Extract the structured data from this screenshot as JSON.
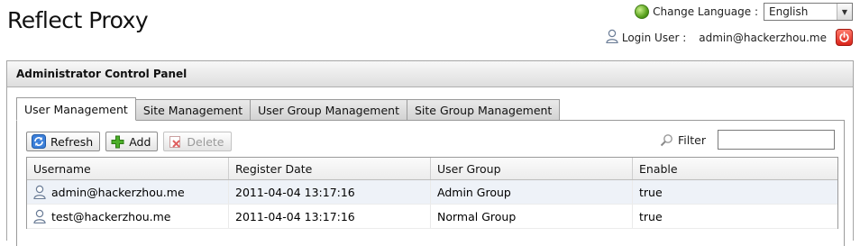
{
  "app": {
    "title": "Reflect Proxy"
  },
  "header": {
    "language_label": "Change Language :",
    "language_value": "English",
    "login_label": "Login User :",
    "login_value": "admin@hackerzhou.me"
  },
  "panel": {
    "title": "Administrator Control Panel"
  },
  "tabs": [
    {
      "label": "User Management",
      "active": true
    },
    {
      "label": "Site Management",
      "active": false
    },
    {
      "label": "User Group Management",
      "active": false
    },
    {
      "label": "Site Group Management",
      "active": false
    }
  ],
  "toolbar": {
    "refresh_label": "Refresh",
    "add_label": "Add",
    "delete_label": "Delete",
    "filter_label": "Filter",
    "filter_value": ""
  },
  "grid": {
    "columns": [
      "Username",
      "Register Date",
      "User Group",
      "Enable"
    ],
    "rows": [
      [
        "admin@hackerzhou.me",
        "2011-04-04 13:17:16",
        "Admin Group",
        "true"
      ],
      [
        "test@hackerzhou.me",
        "2011-04-04 13:17:16",
        "Normal Group",
        "true"
      ]
    ]
  },
  "colors": {
    "header_gradient_top": "#f8f8f8",
    "header_gradient_bottom": "#dedede",
    "row_highlight": "#eef2f8",
    "logout_red": "#d9241a"
  },
  "icons": {
    "language": "globe-icon",
    "login": "user-icon",
    "logout": "power-icon",
    "refresh": "refresh-icon",
    "add": "plus-icon",
    "delete": "delete-icon",
    "filter": "search-icon",
    "row": "user-icon"
  }
}
